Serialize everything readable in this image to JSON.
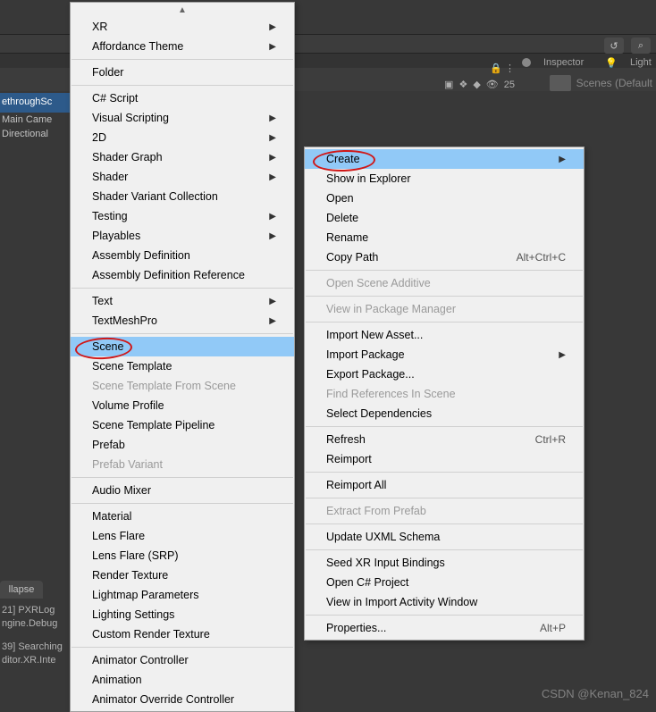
{
  "hierarchy": {
    "selected": "ethroughSc",
    "items": [
      "Main Came",
      "Directional"
    ]
  },
  "collapse_label": "llapse",
  "logs": [
    "21] PXRLog",
    "ngine.Debug",
    "",
    "39] Searching",
    "ditor.XR.Inte"
  ],
  "top_icons": {
    "history": "↺",
    "search": "⌕"
  },
  "inspector": {
    "label": "Inspector",
    "light": "Light"
  },
  "scenes_default": "Scenes (Default",
  "toolbar_visible_count": "25",
  "watermark": "CSDN @Kenan_824",
  "menu_left": [
    {
      "type": "toparrow"
    },
    {
      "label": "XR",
      "sub": true
    },
    {
      "label": "Affordance Theme",
      "sub": true
    },
    {
      "type": "sep"
    },
    {
      "label": "Folder"
    },
    {
      "type": "sep"
    },
    {
      "label": "C# Script"
    },
    {
      "label": "Visual Scripting",
      "sub": true
    },
    {
      "label": "2D",
      "sub": true
    },
    {
      "label": "Shader Graph",
      "sub": true
    },
    {
      "label": "Shader",
      "sub": true
    },
    {
      "label": "Shader Variant Collection"
    },
    {
      "label": "Testing",
      "sub": true
    },
    {
      "label": "Playables",
      "sub": true
    },
    {
      "label": "Assembly Definition"
    },
    {
      "label": "Assembly Definition Reference"
    },
    {
      "type": "sep"
    },
    {
      "label": "Text",
      "sub": true
    },
    {
      "label": "TextMeshPro",
      "sub": true
    },
    {
      "type": "sep"
    },
    {
      "label": "Scene",
      "sel": true
    },
    {
      "label": "Scene Template"
    },
    {
      "label": "Scene Template From Scene",
      "disabled": true
    },
    {
      "label": "Volume Profile"
    },
    {
      "label": "Scene Template Pipeline"
    },
    {
      "label": "Prefab"
    },
    {
      "label": "Prefab Variant",
      "disabled": true
    },
    {
      "type": "sep"
    },
    {
      "label": "Audio Mixer"
    },
    {
      "type": "sep"
    },
    {
      "label": "Material"
    },
    {
      "label": "Lens Flare"
    },
    {
      "label": "Lens Flare (SRP)"
    },
    {
      "label": "Render Texture"
    },
    {
      "label": "Lightmap Parameters"
    },
    {
      "label": "Lighting Settings"
    },
    {
      "label": "Custom Render Texture"
    },
    {
      "type": "sep"
    },
    {
      "label": "Animator Controller"
    },
    {
      "label": "Animation"
    },
    {
      "label": "Animator Override Controller"
    }
  ],
  "menu_right": [
    {
      "label": "Create",
      "sub": true,
      "sel": true
    },
    {
      "label": "Show in Explorer"
    },
    {
      "label": "Open"
    },
    {
      "label": "Delete"
    },
    {
      "label": "Rename"
    },
    {
      "label": "Copy Path",
      "shortcut": "Alt+Ctrl+C"
    },
    {
      "type": "sep"
    },
    {
      "label": "Open Scene Additive",
      "disabled": true
    },
    {
      "type": "sep"
    },
    {
      "label": "View in Package Manager",
      "disabled": true
    },
    {
      "type": "sep"
    },
    {
      "label": "Import New Asset..."
    },
    {
      "label": "Import Package",
      "sub": true
    },
    {
      "label": "Export Package..."
    },
    {
      "label": "Find References In Scene",
      "disabled": true
    },
    {
      "label": "Select Dependencies"
    },
    {
      "type": "sep"
    },
    {
      "label": "Refresh",
      "shortcut": "Ctrl+R"
    },
    {
      "label": "Reimport"
    },
    {
      "type": "sep"
    },
    {
      "label": "Reimport All"
    },
    {
      "type": "sep"
    },
    {
      "label": "Extract From Prefab",
      "disabled": true
    },
    {
      "type": "sep"
    },
    {
      "label": "Update UXML Schema"
    },
    {
      "type": "sep"
    },
    {
      "label": "Seed XR Input Bindings"
    },
    {
      "label": "Open C# Project"
    },
    {
      "label": "View in Import Activity Window"
    },
    {
      "type": "sep"
    },
    {
      "label": "Properties...",
      "shortcut": "Alt+P"
    }
  ]
}
